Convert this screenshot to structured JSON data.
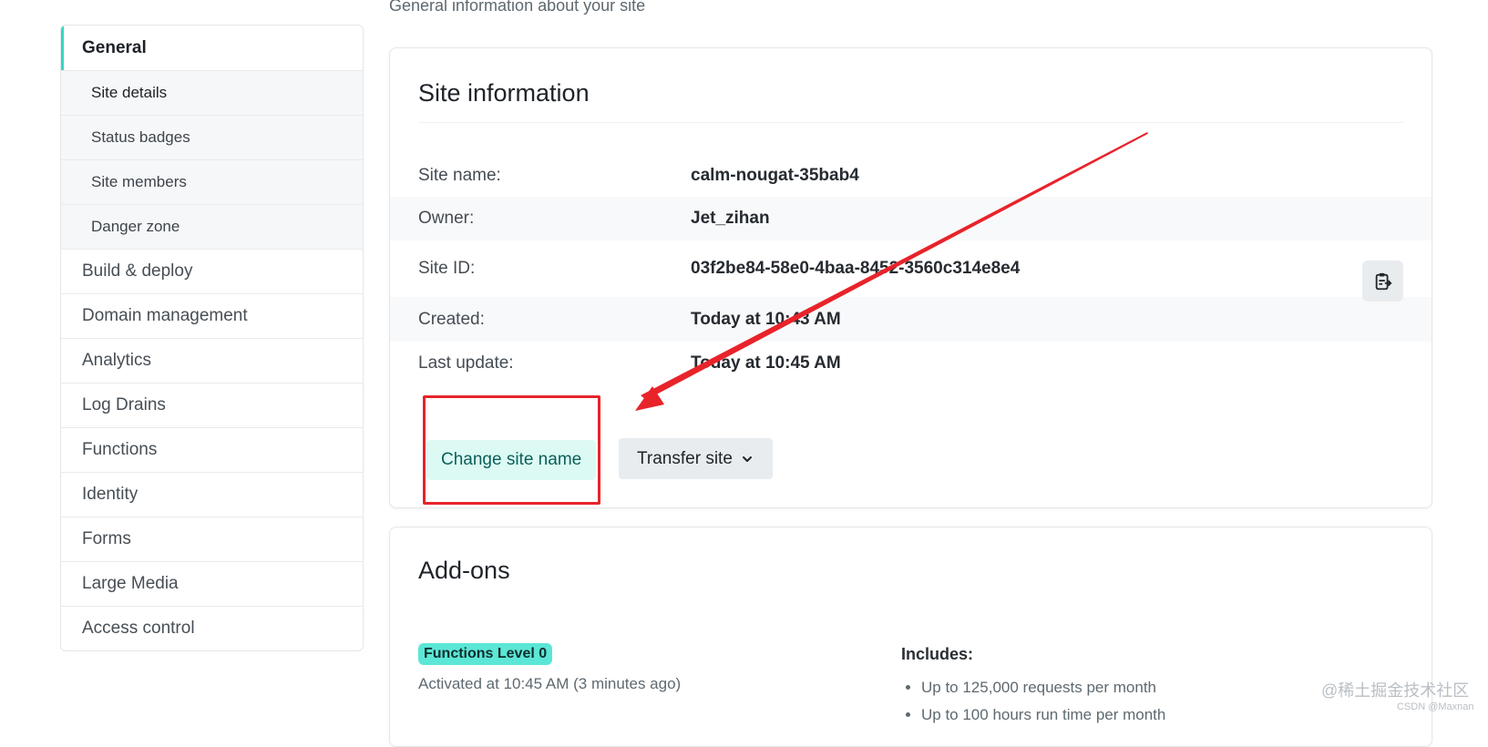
{
  "page": {
    "subtitle": "General information about your site"
  },
  "sidebar": {
    "items": [
      {
        "label": "General",
        "active": true
      },
      {
        "label": "Site details",
        "sub": true,
        "current": true
      },
      {
        "label": "Status badges",
        "sub": true
      },
      {
        "label": "Site members",
        "sub": true
      },
      {
        "label": "Danger zone",
        "sub": true
      },
      {
        "label": "Build & deploy"
      },
      {
        "label": "Domain management"
      },
      {
        "label": "Analytics"
      },
      {
        "label": "Log Drains"
      },
      {
        "label": "Functions"
      },
      {
        "label": "Identity"
      },
      {
        "label": "Forms"
      },
      {
        "label": "Large Media"
      },
      {
        "label": "Access control"
      }
    ]
  },
  "site_info": {
    "title": "Site information",
    "rows": [
      {
        "label": "Site name:",
        "value": "calm-nougat-35bab4"
      },
      {
        "label": "Owner:",
        "value": "Jet_zihan"
      },
      {
        "label": "Site ID:",
        "value": "03f2be84-58e0-4baa-8452-3560c314e8e4"
      },
      {
        "label": "Created:",
        "value": "Today at 10:43 AM"
      },
      {
        "label": "Last update:",
        "value": "Today at 10:45 AM"
      }
    ],
    "copy_icon": "clipboard-copy-icon",
    "change_name_label": "Change site name",
    "transfer_label": "Transfer site",
    "transfer_icon": "chevron-down-icon"
  },
  "addons": {
    "title": "Add-ons",
    "badge": "Functions Level 0",
    "activated": "Activated at 10:45 AM (3 minutes ago)",
    "includes_heading": "Includes:",
    "includes": [
      "Up to 125,000 requests per month",
      "Up to 100 hours run time per month"
    ]
  },
  "annotation": {
    "color": "#e8232a"
  },
  "colors": {
    "accent": "#32d8c4",
    "badge_bg": "#5be6d6",
    "change_btn_bg": "#dcfaf3",
    "change_btn_text": "#0b5f5a"
  },
  "watermark": {
    "main": "@稀土掘金技术社区",
    "small": "CSDN @Maxnan"
  }
}
